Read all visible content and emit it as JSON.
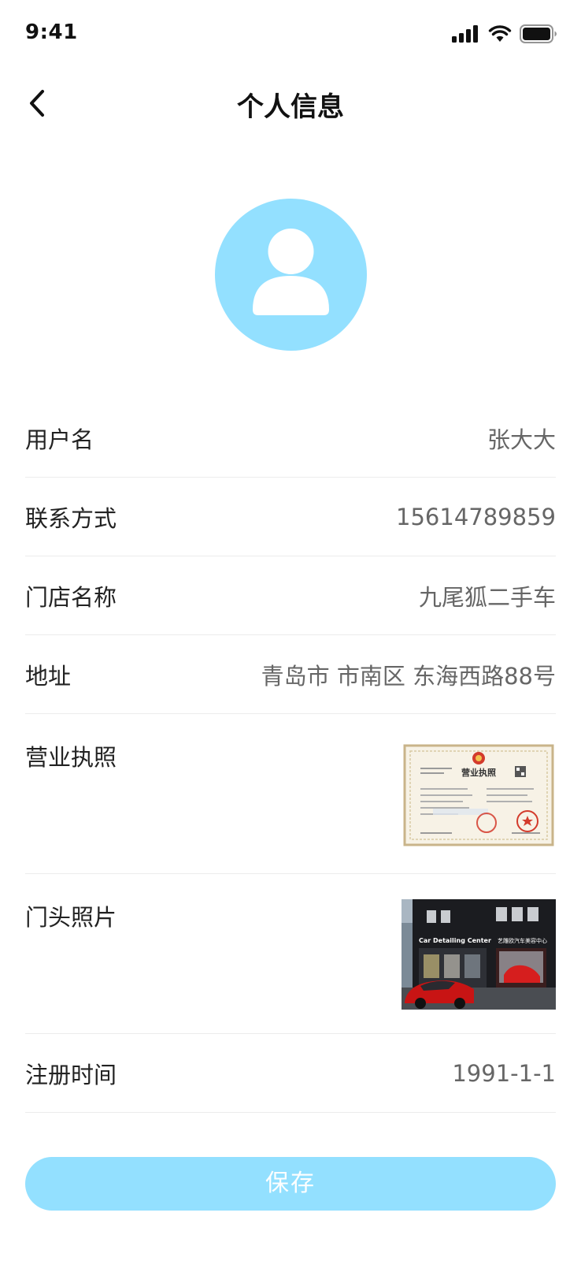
{
  "status_bar": {
    "time": "9:41",
    "icons": [
      "signal-icon",
      "wifi-icon",
      "battery-icon"
    ]
  },
  "header": {
    "back_icon": "chevron-left-icon",
    "title": "个人信息"
  },
  "avatar": {
    "icon": "user-icon",
    "background": "#93e0ff"
  },
  "rows": {
    "username": {
      "label": "用户名",
      "value": "张大大"
    },
    "contact": {
      "label": "联系方式",
      "value": "15614789859"
    },
    "store_name": {
      "label": "门店名称",
      "value": "九尾狐二手车"
    },
    "address": {
      "label": "地址",
      "value": "青岛市 市南区 东海西路88号"
    },
    "business_license": {
      "label": "营业执照",
      "image_title": "营业执照"
    },
    "storefront_photo": {
      "label": "门头照片",
      "image_sign_left": "Car Detailing Center",
      "image_sign_right": "艺雕欧汽车美容中心"
    },
    "register_time": {
      "label": "注册时间",
      "value": "1991-1-1"
    }
  },
  "save_button": {
    "label": "保存"
  },
  "colors": {
    "accent": "#93e0ff",
    "divider": "#ececec",
    "label_text": "#222222",
    "value_text": "#666666"
  }
}
